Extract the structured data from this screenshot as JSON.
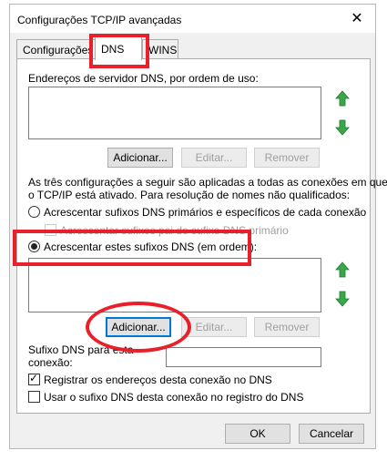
{
  "window": {
    "title": "Configurações TCP/IP avançadas",
    "close_glyph": "✕"
  },
  "tabs": [
    {
      "label": "Configurações IP"
    },
    {
      "label": "DNS"
    },
    {
      "label": "WINS"
    }
  ],
  "dns_servers": {
    "label": "Endereços de servidor DNS, por ordem de uso:",
    "add_label": "Adicionar...",
    "edit_label": "Editar...",
    "remove_label": "Remover",
    "up_icon": "up-arrow-icon",
    "down_icon": "down-arrow-icon"
  },
  "info_text": {
    "line1": "As três configurações a seguir são aplicadas a todas as conexões em que",
    "line2": "o TCP/IP está ativado. Para resolução de nomes não qualificados:"
  },
  "radio_primary": {
    "label": "Acrescentar sufixos DNS primários e específicos de cada conexão",
    "selected": false
  },
  "checkbox_parent": {
    "label": "Acrescentar sufixos pai do sufixo DNS primário",
    "enabled": false
  },
  "radio_these": {
    "label": "Acrescentar estes sufixos DNS (em ordem):",
    "selected": true
  },
  "suffix_list": {
    "add_label": "Adicionar...",
    "edit_label": "Editar...",
    "remove_label": "Remover"
  },
  "connection_suffix": {
    "label_line1": "Sufixo DNS para esta",
    "label_line2": "conexão:",
    "value": ""
  },
  "checkbox_register": {
    "label": "Registrar os endereços desta conexão no DNS",
    "checked": true
  },
  "checkbox_use_suffix": {
    "label": "Usar o sufixo DNS desta conexão no registro do DNS",
    "checked": false
  },
  "footer": {
    "ok_label": "OK",
    "cancel_label": "Cancelar"
  },
  "colors": {
    "highlight": "#e8202a",
    "arrow_green": "#3aa64a",
    "accent": "#0078d7"
  }
}
